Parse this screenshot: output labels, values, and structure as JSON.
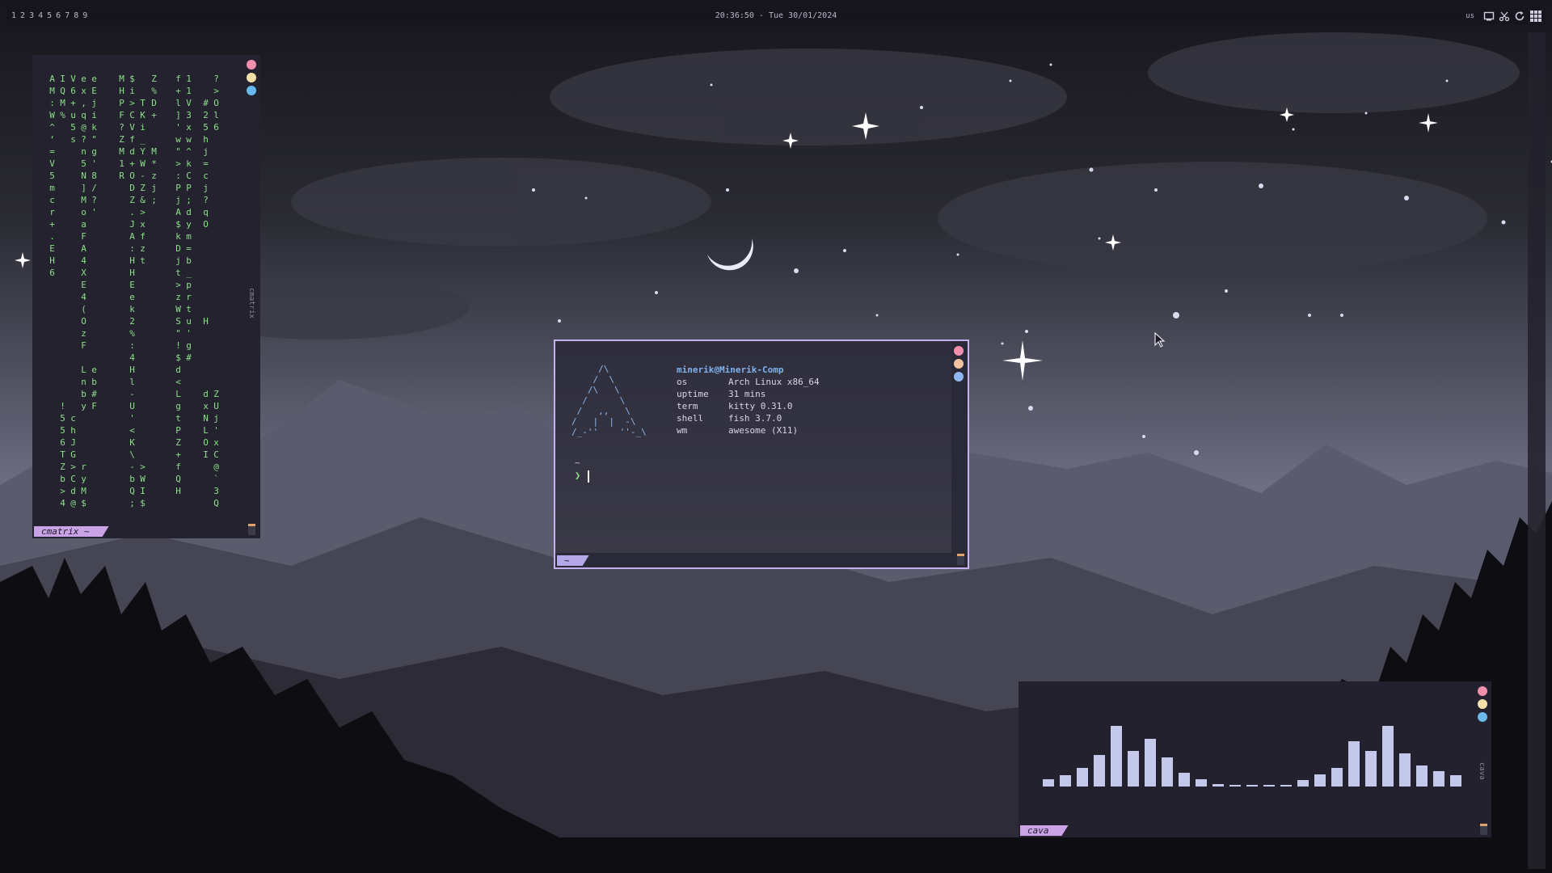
{
  "topbar": {
    "tags": [
      "1",
      "2",
      "3",
      "4",
      "5",
      "6",
      "7",
      "8",
      "9"
    ],
    "clock": "20:36:50 - Tue 30/01/2024",
    "keyboard_layout": "us",
    "tray_icons": [
      "screen-icon",
      "scissors-icon",
      "refresh-icon",
      "grid-icon"
    ]
  },
  "colors": {
    "close": "#f28fad",
    "minimize": "#f5e0a8",
    "maximize": "#6ab8ee",
    "matrix_green": "#8de08a",
    "accent": "#c5b1ec",
    "bars": "#c4c8ea"
  },
  "cmatrix": {
    "title": "cmatrix",
    "tab": "cmatrix ~",
    "columns": [
      "A\nM\n:\nW\n^\n‘\n=\nV\n5\nm\nc\nr\n+\n.\nE\nH\n6",
      "I\nQ\nM\n%\n\n\n\n\n\n\n\n\n\n\n\n\n\n\n\n\n\n\n\n\n\n\n\n!\n5\n5\n6\nT\nZ\nb\n>\n4",
      "V\n6\n+\nu\n5\ns\n\n\n\n\n\n\n\n\n\n\n\n\n\n\n\n\n\n\n\n\n\n\nc\nh\nJ\nG\n>\nC\nd\n@\n&",
      "e\nx\n,\nq\n@\n?\nn\n5\nN\n]\nM\no\na\nF\nA\n4\nX\nE\n4\n(\nO\nz\nF\n\nL\nn\nb\ny\n\n\n\n\nr\ny\nM\n$\nR",
      "e\nE\nj\ni\nk\n\"\ng\n'\n8\n/\n?\n'\n\n\n\n\n\n\n\n\n\n\n\n\ne\nb\n#\nF",
      "M\nH\nP\nF\n?\nZ\nM\n1\nR",
      "$\ni\n>\nC\nV\nf\nd\n+\nO\nD\nZ\n.\nJ\nA\n:\nH\nH\nE\ne\nk\n2\n%\n:\n4\nH\nl\n-\nU\n'\n<\nK\n\\\n-\nb\nQ\n;",
      "\n\nT\nK\ni\n_\nY\nW\n-\nZ\n&\n>\nx\nf\nz\nt\n\n\n\n\n\n\n\n\n\n\n\n\n\n\n\n\n>\nW\nI\n$",
      "Z\n%\nD\n+\n\n\nM\n*\nz\nj\n;",
      "f\n+\nl\n]\n'\nw\n\"\n>\n:\nP\nj\nA\n$\nk\nD\nj\nt\n>\nz\nW\nS\n\"\n!\n$\nd\n<\nL\ng\nt\nP\nZ\n+\nf\nQ\nH",
      "1\n1\nV\n3\nx\nw\n^\nk\nC\nP\n;\nd\ny\nm\n=\nb\n_\np\nr\nt\nu\n'\ng\n#\n\n\n\n\n\n\n\n\n\n\n\n\n\n\n\n\n\n\n\n\n\n\n\n\n\n\n\n\n\n\n\n\n\n\n\n\n\n\n\n\n\n\n\n\n\n\n\n\n\n\n\n\n\n\n\n\n",
      "\n\n#\n2\n5\nh\nj\n=\nc\nj\n?\nq\nO\n\n\n\n\n\n\n\nH\n\n\n\n\n\nd\nx\nN\nL\nO\nI",
      "?\n>\nO\nl\n6\n\n\n\n\n\n\n\n\n\n\n\n\n\n\n\n\n\n\n\n\n\nZ\nU\nj\n'\nx\nC\n@\n`\n3\nQ\nB\n[\nv\nV\nI\nl"
    ]
  },
  "kitty": {
    "user_host": "minerik@Minerik-Comp",
    "info": [
      {
        "key": "os",
        "value": "Arch Linux x86_64"
      },
      {
        "key": "uptime",
        "value": "31 mins"
      },
      {
        "key": "term",
        "value": "kitty 0.31.0"
      },
      {
        "key": "shell",
        "value": "fish 3.7.0"
      },
      {
        "key": "wm",
        "value": "awesome (X11)"
      }
    ],
    "cwd": "~",
    "prompt_symbol": "❯",
    "tab": "~",
    "logo": "     /\\\n    /  \\\n   /\\   \\\n  /      \\\n /   ,,   \\\n/   |  |  -\\\n/_-''    ''-_\\"
  },
  "cava": {
    "title": "cava",
    "tab": "cava",
    "levels": [
      0.12,
      0.18,
      0.3,
      0.52,
      1.0,
      0.58,
      0.78,
      0.48,
      0.22,
      0.12,
      0.04,
      0.03,
      0.03,
      0.03,
      0.03,
      0.1,
      0.2,
      0.3,
      0.75,
      0.58,
      1.0,
      0.55,
      0.35,
      0.25,
      0.18
    ]
  }
}
